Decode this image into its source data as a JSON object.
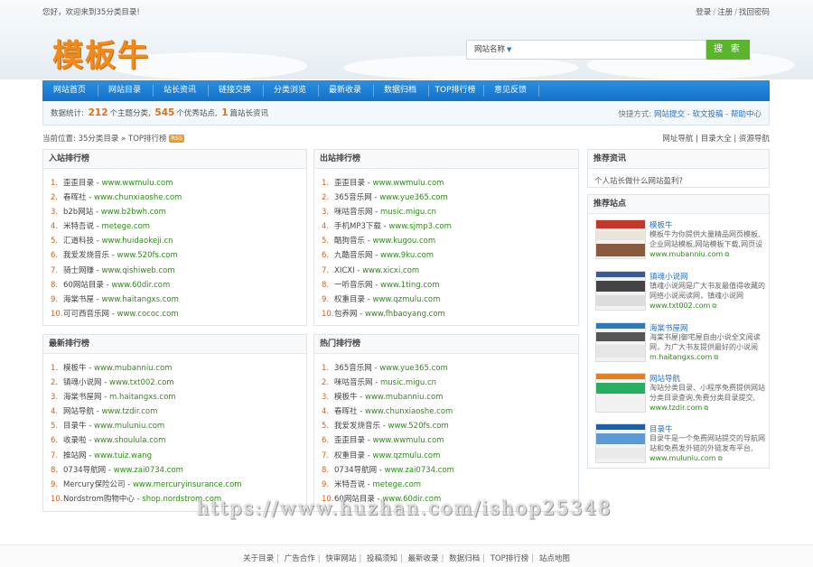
{
  "topbar": {
    "welcome": "您好，欢迎来到35分类目录!",
    "login": "登录",
    "register": "注册",
    "forgot": "找回密码"
  },
  "logo": {
    "text": "模板牛",
    "color": "#f08a1c"
  },
  "search": {
    "category": "网站名称",
    "value": "",
    "button": "搜 索",
    "button_color": "#5ab52d"
  },
  "nav": {
    "color": "#1a7bd6",
    "items": [
      {
        "label": "网站首页"
      },
      {
        "label": "网站目录"
      },
      {
        "label": "站长资讯"
      },
      {
        "label": "链接交换"
      },
      {
        "label": "分类浏览"
      },
      {
        "label": "最新收录"
      },
      {
        "label": "数据归档"
      },
      {
        "label": "TOP排行榜"
      },
      {
        "label": "意见反馈"
      }
    ]
  },
  "stats": {
    "prefix": "数据统计:",
    "categories_count": "212",
    "categories_text": "个主题分类,",
    "sites_count": "545",
    "sites_text": "个优秀站点,",
    "news_count": "1",
    "news_text": "篇站长资讯"
  },
  "quick": {
    "label": "快捷方式:",
    "links": [
      "网站提交",
      "软文投稿",
      "帮助中心"
    ]
  },
  "breadcrumb": {
    "prefix": "当前位置:",
    "root": "35分类目录",
    "current": "TOP排行榜",
    "rss": "RSS"
  },
  "crumb_right": {
    "links": [
      "网址导航",
      "目录大全",
      "资源导航"
    ]
  },
  "rankings": {
    "in": {
      "title": "入站排行榜",
      "items": [
        {
          "num": "1.",
          "name": "歪歪目录",
          "domain": "www.wwmulu.com"
        },
        {
          "num": "2.",
          "name": "春晖社",
          "domain": "www.chunxiaoshe.com"
        },
        {
          "num": "3.",
          "name": "b2b网站",
          "domain": "www.b2bwh.com"
        },
        {
          "num": "4.",
          "name": "米特吾说",
          "domain": "metege.com"
        },
        {
          "num": "5.",
          "name": "汇道科技",
          "domain": "www.huidaokeji.cn"
        },
        {
          "num": "6.",
          "name": "我爱发烧音乐",
          "domain": "www.520fs.com"
        },
        {
          "num": "7.",
          "name": "骑士网赚",
          "domain": "www.qishiweb.com"
        },
        {
          "num": "8.",
          "name": "60网站目录",
          "domain": "www.60dir.com"
        },
        {
          "num": "9.",
          "name": "海棠书屋",
          "domain": "www.haitangxs.com"
        },
        {
          "num": "10.",
          "name": "可可西音乐网",
          "domain": "www.cococ.com"
        }
      ]
    },
    "out": {
      "title": "出站排行榜",
      "items": [
        {
          "num": "1.",
          "name": "歪歪目录",
          "domain": "www.wwmulu.com"
        },
        {
          "num": "2.",
          "name": "365音乐网",
          "domain": "www.yue365.com"
        },
        {
          "num": "3.",
          "name": "咪咕音乐网",
          "domain": "music.migu.cn"
        },
        {
          "num": "4.",
          "name": "手机MP3下载",
          "domain": "www.sjmp3.com"
        },
        {
          "num": "5.",
          "name": "酷狗音乐",
          "domain": "www.kugou.com"
        },
        {
          "num": "6.",
          "name": "九酷音乐网",
          "domain": "www.9ku.com"
        },
        {
          "num": "7.",
          "name": "XICXI",
          "domain": "www.xicxi.com"
        },
        {
          "num": "8.",
          "name": "一听音乐网",
          "domain": "www.1ting.com"
        },
        {
          "num": "9.",
          "name": "权重目录",
          "domain": "www.qzmulu.com"
        },
        {
          "num": "10.",
          "name": "包养网",
          "domain": "www.fhbaoyang.com"
        }
      ]
    },
    "latest": {
      "title": "最新排行榜",
      "items": [
        {
          "num": "1.",
          "name": "模板牛",
          "domain": "www.mubanniu.com"
        },
        {
          "num": "2.",
          "name": "镇魂小说网",
          "domain": "www.txt002.com"
        },
        {
          "num": "3.",
          "name": "海棠书屋网",
          "domain": "m.haitangxs.com"
        },
        {
          "num": "4.",
          "name": "网站导航",
          "domain": "www.tzdir.com"
        },
        {
          "num": "5.",
          "name": "目录牛",
          "domain": "www.muluniu.com"
        },
        {
          "num": "6.",
          "name": "收录啦",
          "domain": "www.shoulula.com"
        },
        {
          "num": "7.",
          "name": "推站网",
          "domain": "www.tuiz.wang"
        },
        {
          "num": "8.",
          "name": "0734导航网",
          "domain": "www.zai0734.com"
        },
        {
          "num": "9.",
          "name": "Mercury保险公司",
          "domain": "www.mercuryinsurance.com"
        },
        {
          "num": "10.",
          "name": "Nordstrom购物中心",
          "domain": "shop.nordstrom.com"
        }
      ]
    },
    "hot": {
      "title": "热门排行榜",
      "items": [
        {
          "num": "1.",
          "name": "365音乐网",
          "domain": "www.yue365.com"
        },
        {
          "num": "2.",
          "name": "咪咕音乐网",
          "domain": "music.migu.cn"
        },
        {
          "num": "3.",
          "name": "模板牛",
          "domain": "www.mubanniu.com"
        },
        {
          "num": "4.",
          "name": "春晖社",
          "domain": "www.chunxiaoshe.com"
        },
        {
          "num": "5.",
          "name": "我爱发烧音乐",
          "domain": "www.520fs.com"
        },
        {
          "num": "6.",
          "name": "歪歪目录",
          "domain": "www.wwmulu.com"
        },
        {
          "num": "7.",
          "name": "权重目录",
          "domain": "www.qzmulu.com"
        },
        {
          "num": "8.",
          "name": "0734导航网",
          "domain": "www.zai0734.com"
        },
        {
          "num": "9.",
          "name": "米特吾说",
          "domain": "metege.com"
        },
        {
          "num": "10.",
          "name": "60网站目录",
          "domain": "www.60dir.com"
        }
      ]
    }
  },
  "sidebar": {
    "news_title": "推荐资讯",
    "news_item": "个人站长做什么网站盈利?",
    "sites_title": "推荐站点",
    "sites": [
      {
        "name": "模板牛",
        "desc": "模板牛为你提供大量精品网页模板,企业网站模板,网站模板下载,网页设",
        "url": "www.mubanniu.com"
      },
      {
        "name": "镇魂小说网",
        "desc": "镇魂小说网是广大书友最值得收藏的网络小说阅读网，镇魂小说网",
        "url": "www.txt002.com"
      },
      {
        "name": "海棠书屋网",
        "desc": "海棠书屋|御宅屋自由小说全文阅读网，为广大书友提供最好的小说阅",
        "url": "m.haitangxs.com"
      },
      {
        "name": "网站导航",
        "desc": "淘站分类目录、小程序免费提供网站分类目录查询,免费分类目录提交,",
        "url": "www.tzdir.com"
      },
      {
        "name": "目录牛",
        "desc": "目录牛是一个免费网站提交的导航网站和免费发外链的外链发布平台,",
        "url": "www.muluniu.com"
      }
    ]
  },
  "watermark": "https://www.huzhan.com/ishop25348",
  "footer": {
    "links": [
      "关于目录",
      "广告合作",
      "快审网站",
      "投稿须知",
      "最新收录",
      "数据归档",
      "TOP排行榜",
      "站点地图"
    ]
  }
}
